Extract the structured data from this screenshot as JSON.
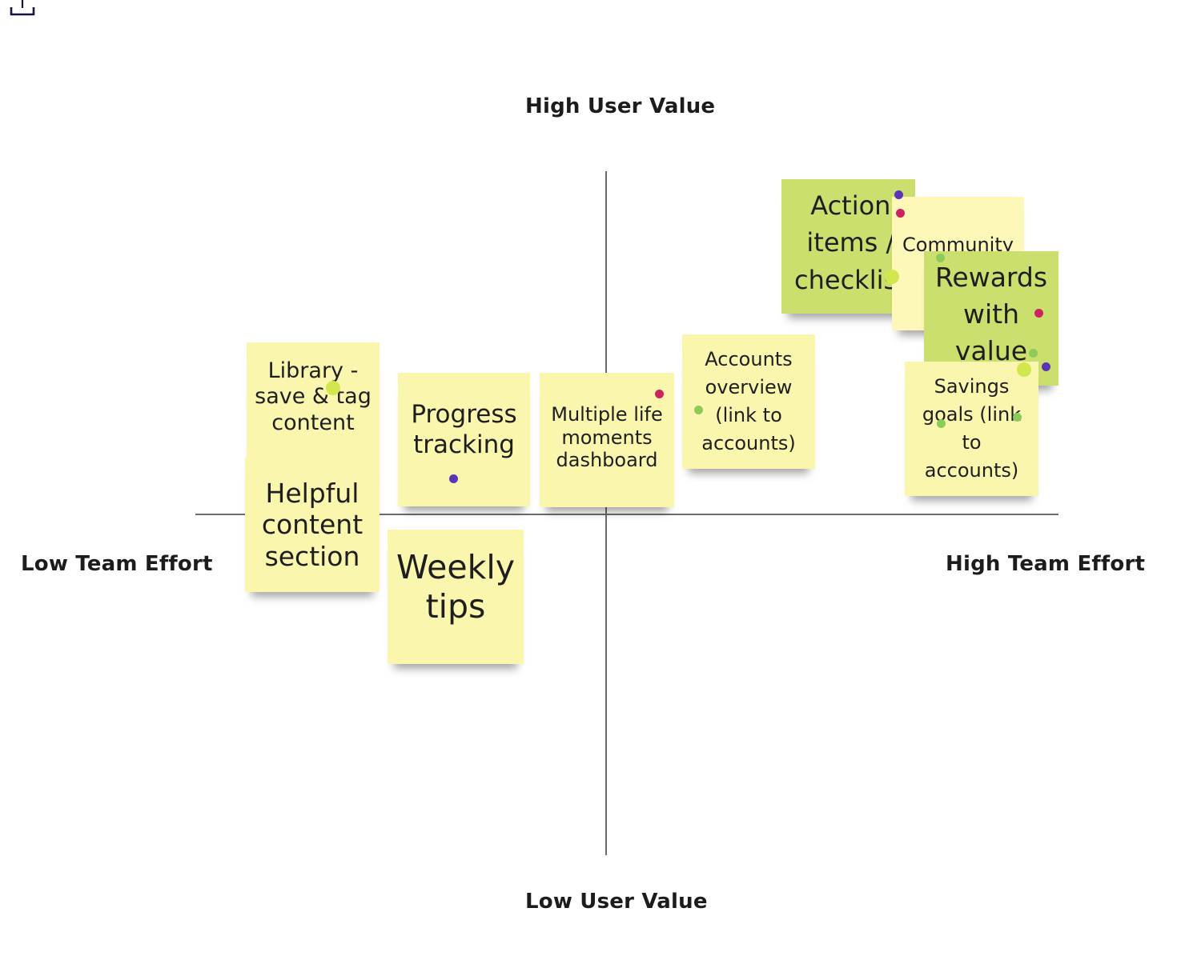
{
  "toolbar": {
    "export_icon": "export-upload-icon"
  },
  "axes": {
    "top": "High User Value",
    "bottom": "Low User Value",
    "left": "Low Team Effort",
    "right": "High Team Effort"
  },
  "colors": {
    "sticky_yellow": "#fbf6ad",
    "sticky_green": "#cadf6e",
    "dot_purple": "#5b34b8",
    "dot_pink": "#cc2460",
    "dot_green": "#8ccb5a",
    "dot_lime": "#d2e64f",
    "axis_line": "#6b6b6b"
  },
  "stickies": [
    {
      "id": "library",
      "text": "Library -\nsave & tag\ncontent",
      "color": "yellow"
    },
    {
      "id": "helpful",
      "text": "Helpful\ncontent\nsection",
      "color": "yellow"
    },
    {
      "id": "progress",
      "text": "Progress\ntracking",
      "color": "yellow"
    },
    {
      "id": "weekly",
      "text": "Weekly\ntips",
      "color": "yellow"
    },
    {
      "id": "multiple",
      "text": "Multiple life\nmoments\ndashboard",
      "color": "yellow"
    },
    {
      "id": "accounts",
      "text": "Accounts\noverview\n(link to\naccounts)",
      "color": "yellow"
    },
    {
      "id": "action",
      "text": "Action\nitems /\nchecklist",
      "color": "green"
    },
    {
      "id": "community",
      "text": "Community",
      "color": "yellow"
    },
    {
      "id": "rewards",
      "text": "Rewards\nwith\nvalue",
      "color": "green"
    },
    {
      "id": "savings",
      "text": "Savings\ngoals (link\nto\naccounts)",
      "color": "yellow"
    }
  ],
  "votes": [
    {
      "sticky": "library",
      "color": "lime"
    },
    {
      "sticky": "progress",
      "color": "purple"
    },
    {
      "sticky": "multiple",
      "color": "pink"
    },
    {
      "sticky": "accounts",
      "color": "green"
    },
    {
      "sticky": "action",
      "color": "purple"
    },
    {
      "sticky": "action",
      "color": "pink"
    },
    {
      "sticky": "action",
      "color": "lime"
    },
    {
      "sticky": "rewards",
      "color": "green"
    },
    {
      "sticky": "rewards",
      "color": "pink"
    },
    {
      "sticky": "rewards",
      "color": "green"
    },
    {
      "sticky": "rewards",
      "color": "purple"
    },
    {
      "sticky": "rewards",
      "color": "lime"
    },
    {
      "sticky": "savings",
      "color": "green"
    },
    {
      "sticky": "savings",
      "color": "green"
    }
  ]
}
